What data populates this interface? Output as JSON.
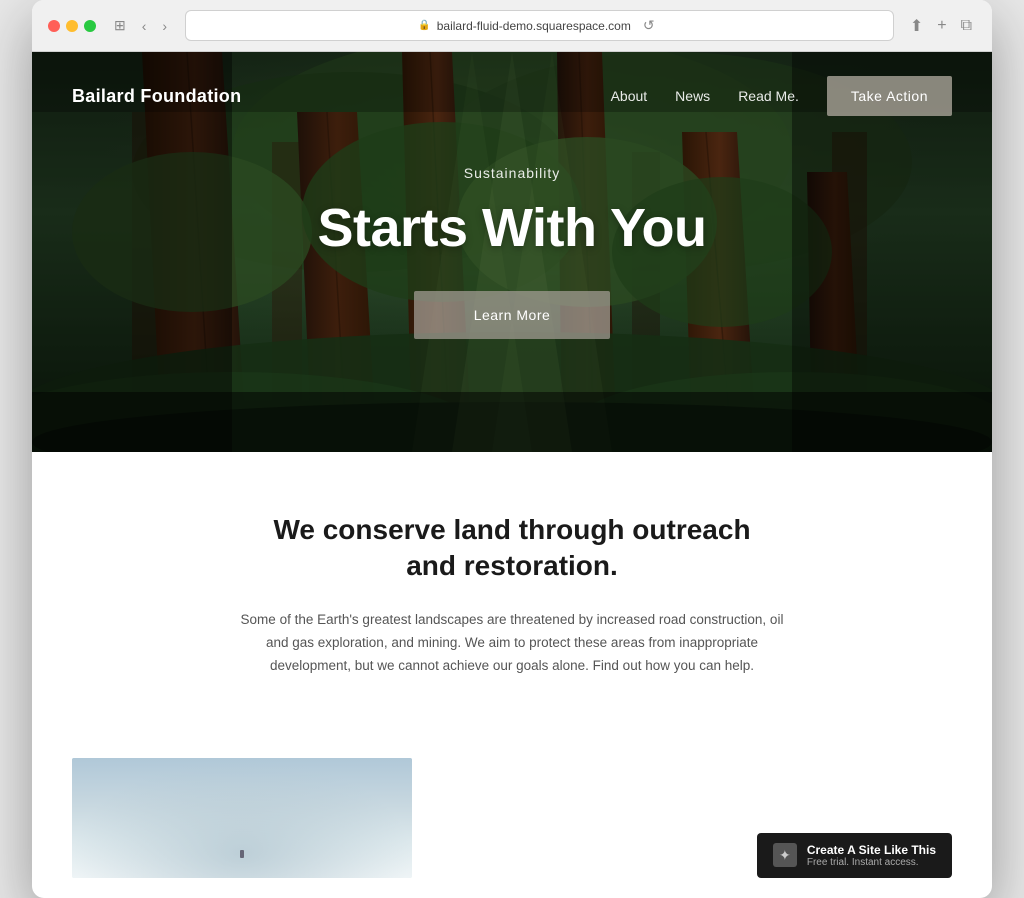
{
  "browser": {
    "url": "bailard-fluid-demo.squarespace.com",
    "back_btn": "‹",
    "forward_btn": "›",
    "reload_btn": "↺",
    "share_btn": "⬆",
    "new_tab_btn": "+",
    "tab_btn": "⧉"
  },
  "navbar": {
    "logo": "Bailard Foundation",
    "links": [
      "About",
      "News",
      "Read Me."
    ],
    "cta_label": "Take Action"
  },
  "hero": {
    "subtitle": "Sustainability",
    "title": "Starts With You",
    "learn_more_label": "Learn More"
  },
  "main": {
    "heading": "We conserve land through outreach and restoration.",
    "body": "Some of the Earth's greatest landscapes are threatened by increased road construction, oil and gas exploration, and mining. We aim to protect these areas from inappropriate development, but we cannot achieve our goals alone. Find out how you can help."
  },
  "squarespace_badge": {
    "title": "Create A Site Like This",
    "subtitle": "Free trial. Instant access.",
    "logo_symbol": "✦"
  }
}
